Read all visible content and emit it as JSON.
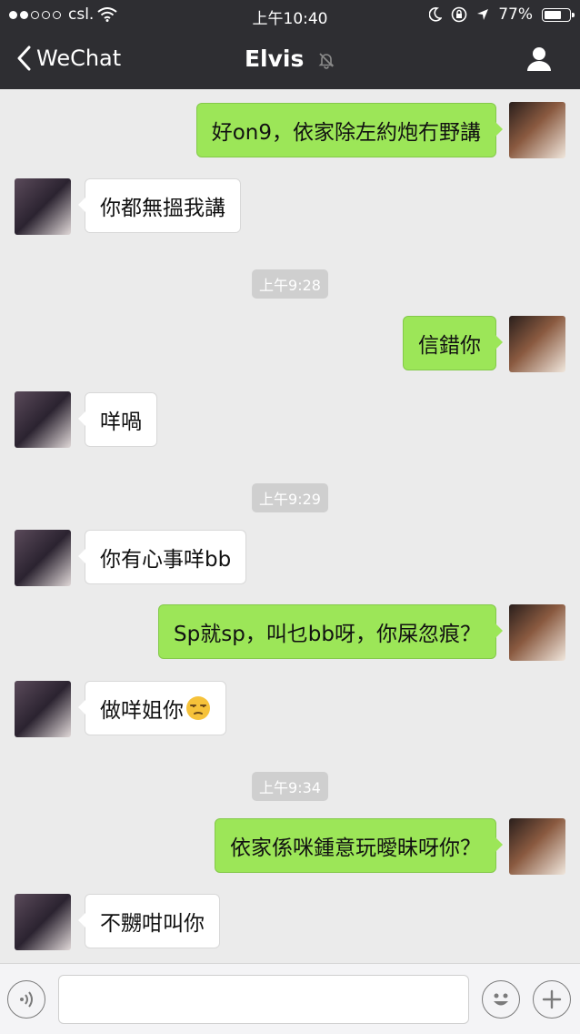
{
  "status_bar": {
    "carrier": "csl.",
    "time": "上午10:40",
    "battery": "77%",
    "battery_level": 0.77
  },
  "nav": {
    "back_label": "WeChat",
    "title": "Elvis"
  },
  "messages": [
    {
      "side": "me",
      "text": "好on9，依家除左約炮冇野講"
    },
    {
      "side": "them",
      "text": "你都無搵我講"
    },
    {
      "type": "time",
      "text": "上午9:28"
    },
    {
      "side": "me",
      "text": "信錯你"
    },
    {
      "side": "them",
      "text": "咩喎"
    },
    {
      "type": "time",
      "text": "上午9:29"
    },
    {
      "side": "them",
      "text": "你有心事咩bb"
    },
    {
      "side": "me",
      "text": "Sp就sp，叫乜bb呀，你屎忽痕？"
    },
    {
      "side": "them",
      "text": "做咩姐你",
      "emoji": "unamused-face"
    },
    {
      "type": "time",
      "text": "上午9:34"
    },
    {
      "side": "me",
      "text": "依家係咪鍾意玩曖昧呀你？"
    },
    {
      "side": "them",
      "text": "不嬲咁叫你"
    }
  ],
  "input": {
    "value": "",
    "placeholder": ""
  },
  "icons": {
    "voice": "voice-icon",
    "emoji": "emoji-icon",
    "plus": "plus-icon",
    "profile": "profile-icon",
    "mute": "mute-icon"
  },
  "colors": {
    "topbar": "#2e2e32",
    "background": "#ebebeb",
    "my_bubble": "#9ce658",
    "their_bubble": "#ffffff"
  }
}
